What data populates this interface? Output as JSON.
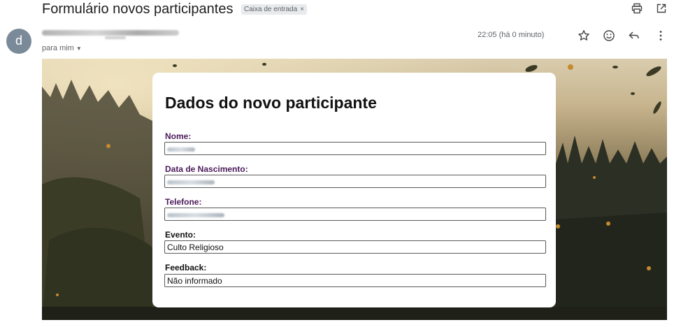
{
  "email": {
    "subject": "Formulário novos participantes",
    "label": "Caixa de entrada",
    "label_close": "×",
    "avatar_letter": "d",
    "to": "para mim",
    "timestamp": "22:05 (há 0 minuto)"
  },
  "form": {
    "title": "Dados do novo participante",
    "fields": [
      {
        "label": "Nome:",
        "value": ""
      },
      {
        "label": "Data de Nascimento:",
        "value": ""
      },
      {
        "label": "Telefone:",
        "value": ""
      },
      {
        "label": "Evento:",
        "value": "Culto Religioso"
      },
      {
        "label": "Feedback:",
        "value": "Não informado"
      }
    ]
  },
  "colors": {
    "label_purple": "#4b1a5a",
    "avatar": "#7b8a99"
  },
  "icons": [
    "print-icon",
    "open-in-new-window-icon",
    "star-icon",
    "emoji-icon",
    "reply-icon",
    "more-vert-icon"
  ]
}
